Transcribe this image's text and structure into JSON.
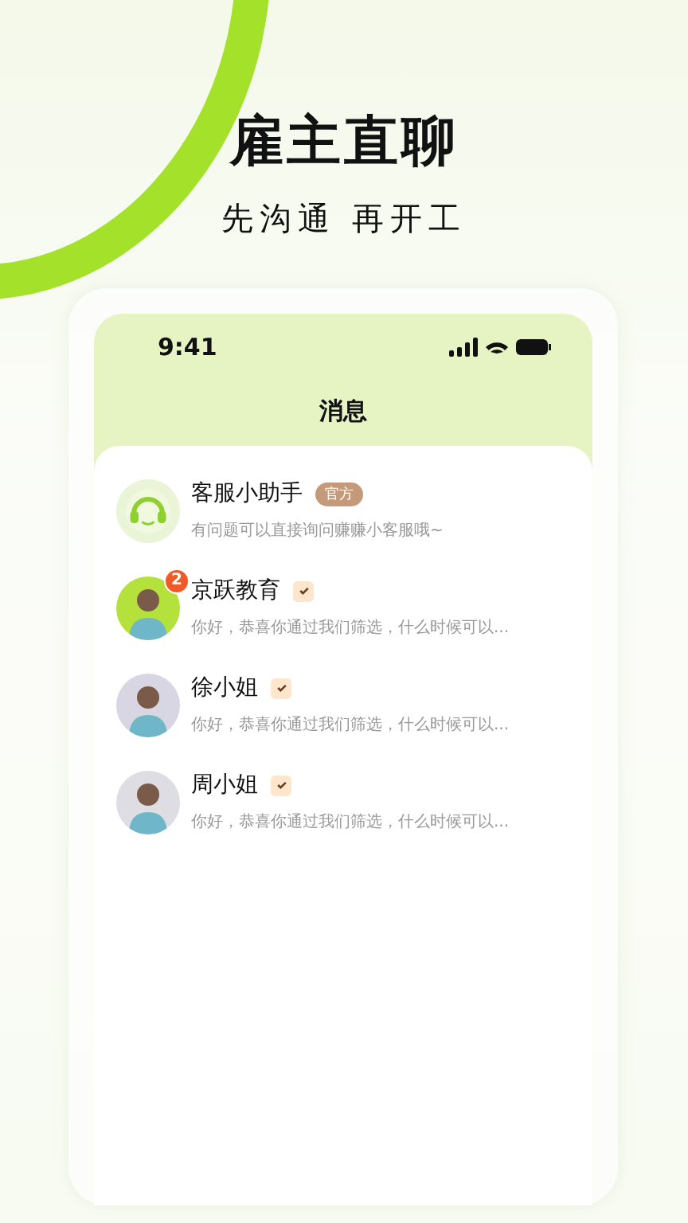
{
  "headline": "雇主直聊",
  "subheadline": "先沟通 再开工",
  "phone": {
    "status_bar": {
      "time": "9:41"
    },
    "title": "消息",
    "conversations": [
      {
        "kind": "service",
        "name": "客服小助手",
        "tag": "官方",
        "preview": "有问题可以直接询问赚赚小客服哦~"
      },
      {
        "kind": "person",
        "name": "京跃教育",
        "verified": true,
        "unread": "2",
        "preview": "你好，恭喜你通过我们筛选，什么时候可以...",
        "color": "#b5e13c"
      },
      {
        "kind": "person",
        "name": "徐小姐",
        "verified": true,
        "preview": "你好，恭喜你通过我们筛选，什么时候可以...",
        "color": "#d8d6e2"
      },
      {
        "kind": "person",
        "name": "周小姐",
        "verified": true,
        "preview": "你好，恭喜你通过我们筛选，什么时候可以...",
        "color": "#dedde3"
      }
    ]
  }
}
